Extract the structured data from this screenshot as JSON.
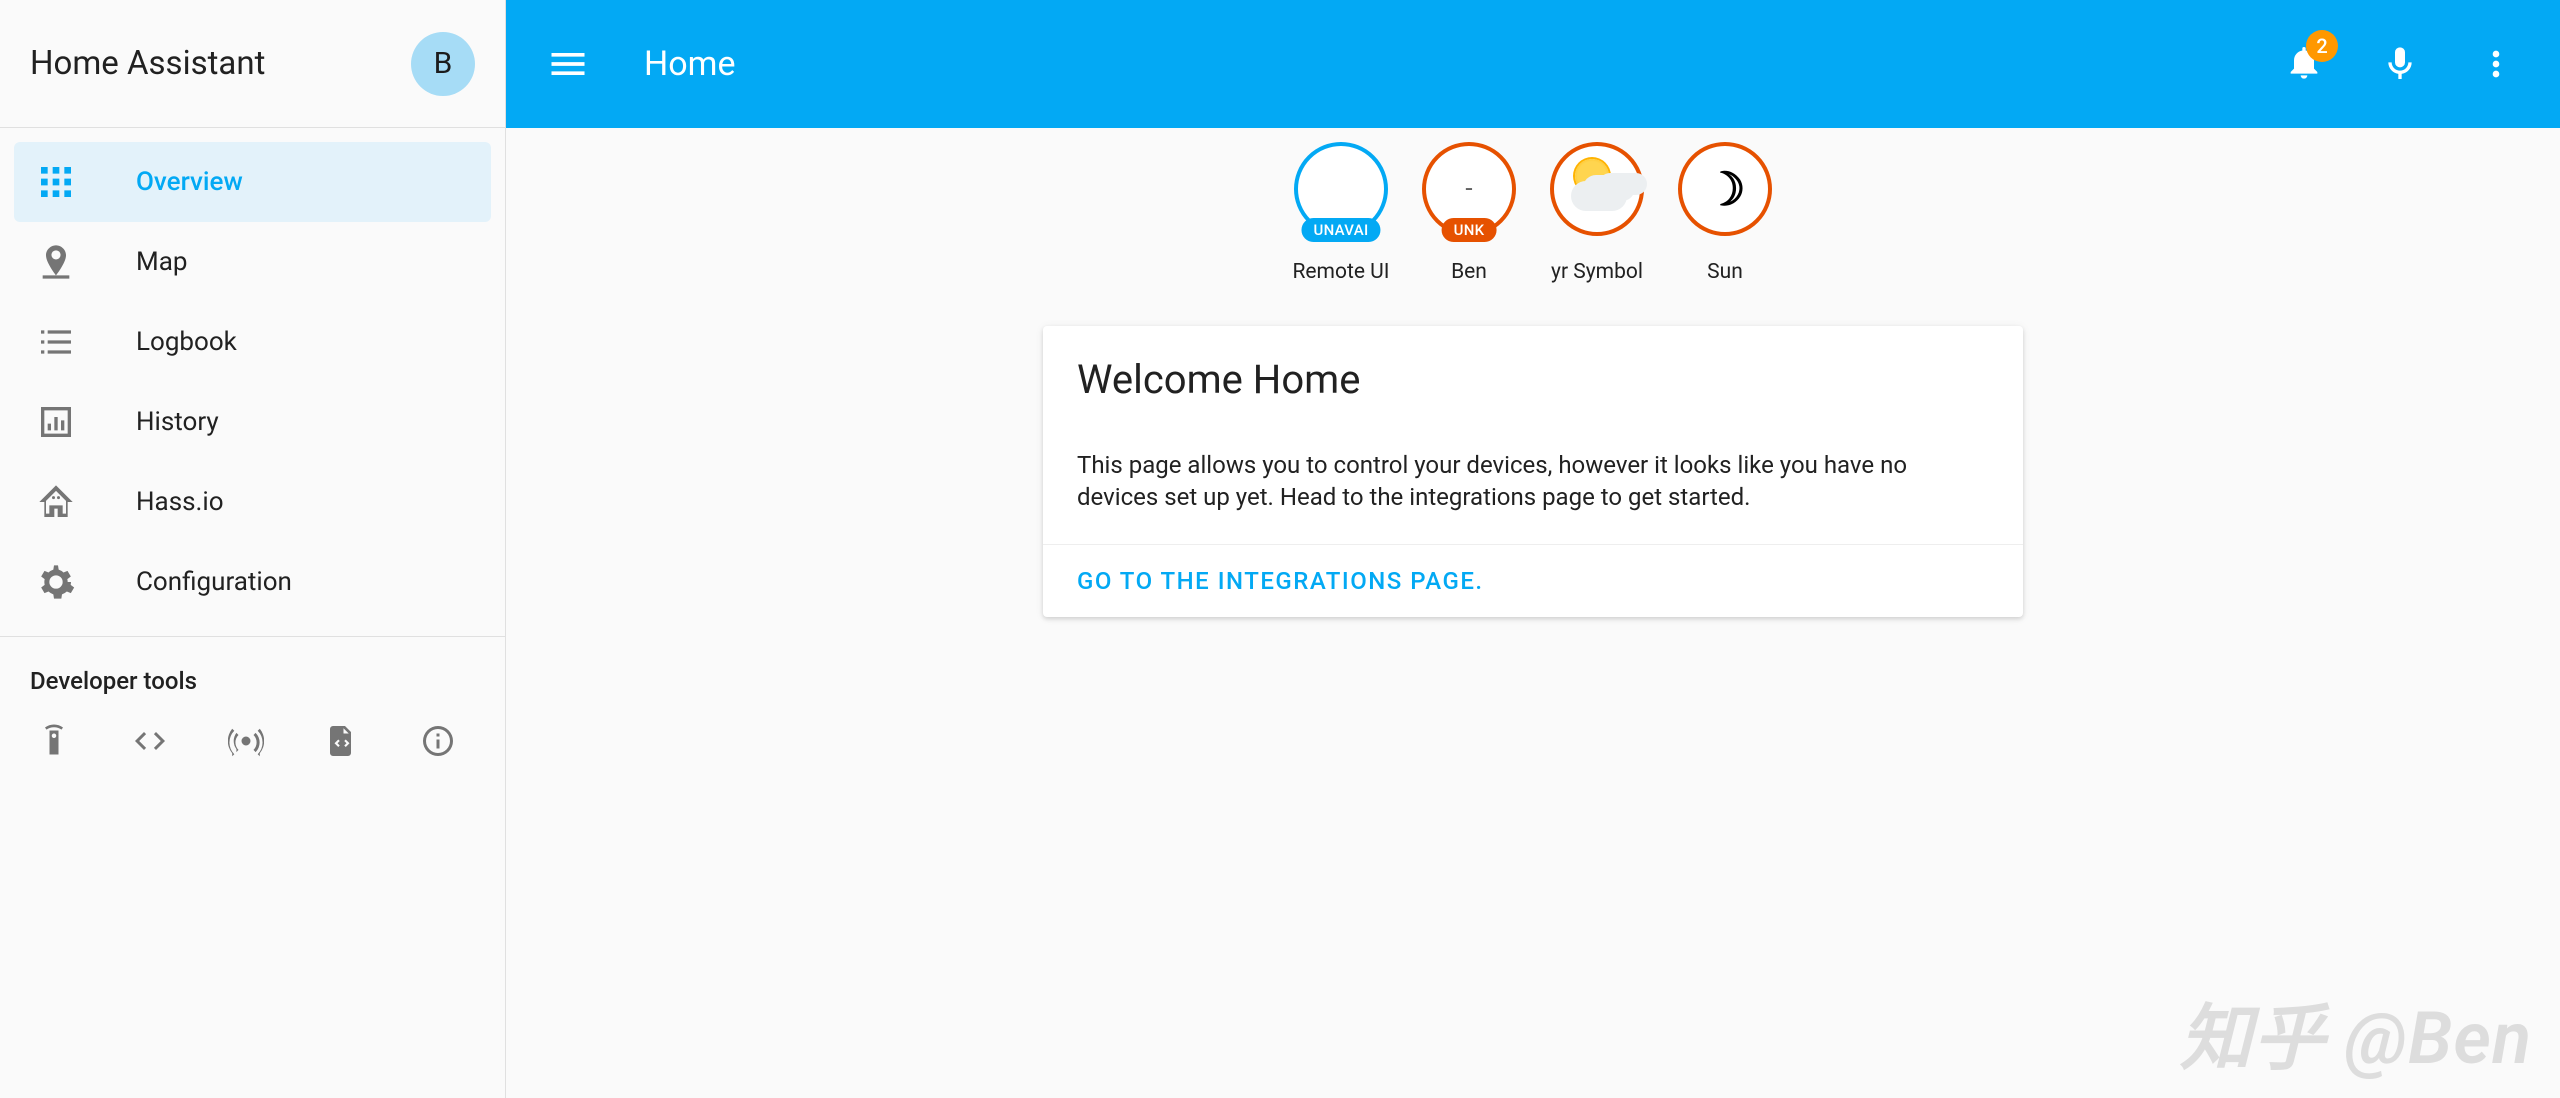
{
  "app": {
    "title": "Home Assistant"
  },
  "user": {
    "initial": "B"
  },
  "sidebar": {
    "items": [
      {
        "id": "overview",
        "label": "Overview",
        "icon": "dashboard-icon",
        "active": true
      },
      {
        "id": "map",
        "label": "Map",
        "icon": "map-marker-icon",
        "active": false
      },
      {
        "id": "logbook",
        "label": "Logbook",
        "icon": "list-icon",
        "active": false
      },
      {
        "id": "history",
        "label": "History",
        "icon": "chart-icon",
        "active": false
      },
      {
        "id": "hassio",
        "label": "Hass.io",
        "icon": "home-assistant-icon",
        "active": false
      },
      {
        "id": "configuration",
        "label": "Configuration",
        "icon": "gear-icon",
        "active": false
      }
    ],
    "dev_title": "Developer tools",
    "dev_icons": [
      {
        "id": "remote",
        "icon": "remote-icon"
      },
      {
        "id": "template",
        "icon": "code-icon"
      },
      {
        "id": "events",
        "icon": "radio-tower-icon"
      },
      {
        "id": "services",
        "icon": "file-code-icon"
      },
      {
        "id": "info",
        "icon": "info-icon"
      }
    ]
  },
  "header": {
    "title": "Home",
    "notification_count": "2"
  },
  "badges": [
    {
      "id": "remote_ui",
      "label": "Remote UI",
      "border": "blue",
      "pill": "UNAVAI",
      "pill_color": "blue",
      "body": "empty"
    },
    {
      "id": "ben",
      "label": "Ben",
      "border": "orange",
      "pill": "UNK",
      "pill_color": "orange",
      "body": "dash"
    },
    {
      "id": "yr_symbol",
      "label": "yr Symbol",
      "border": "orange",
      "pill": null,
      "body": "sun-cloud"
    },
    {
      "id": "sun",
      "label": "Sun",
      "border": "orange",
      "pill": null,
      "body": "moon"
    }
  ],
  "card": {
    "title": "Welcome Home",
    "body": "This page allows you to control your devices, however it looks like you have no devices set up yet. Head to the integrations page to get started.",
    "action_label": "GO TO THE INTEGRATIONS PAGE."
  },
  "watermark": "知乎 @Ben",
  "colors": {
    "primary": "#03a9f4",
    "accent_orange": "#e65100",
    "notif_badge": "#ff9800"
  }
}
